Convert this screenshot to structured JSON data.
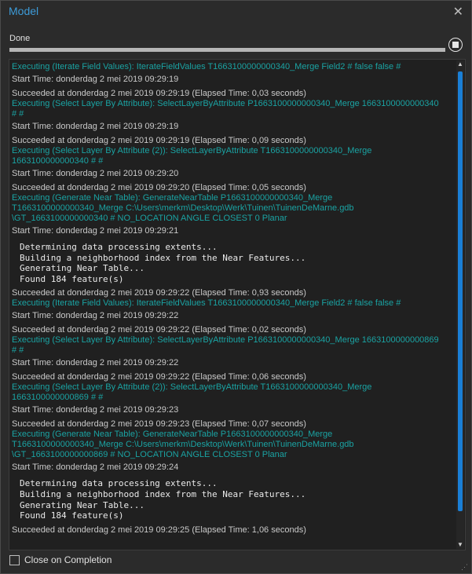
{
  "window": {
    "title": "Model"
  },
  "status": {
    "text": "Done",
    "progress": 1.0
  },
  "log": [
    {
      "kind": "exec",
      "text": "Executing (Iterate Field Values): IterateFieldValues T1663100000000340_Merge Field2 # false false #"
    },
    {
      "kind": "plain",
      "text": "Start Time: donderdag 2 mei 2019 09:29:19"
    },
    {
      "kind": "plain",
      "text": "Succeeded at donderdag 2 mei 2019 09:29:19 (Elapsed Time: 0,03 seconds)"
    },
    {
      "kind": "exec",
      "text": "Executing (Select Layer By Attribute): SelectLayerByAttribute P1663100000000340_Merge 1663100000000340"
    },
    {
      "kind": "exec",
      "text": "# #"
    },
    {
      "kind": "plain",
      "text": "Start Time: donderdag 2 mei 2019 09:29:19"
    },
    {
      "kind": "plain",
      "text": "Succeeded at donderdag 2 mei 2019 09:29:19 (Elapsed Time: 0,09 seconds)"
    },
    {
      "kind": "exec",
      "text": "Executing (Select Layer By Attribute (2)): SelectLayerByAttribute T1663100000000340_Merge"
    },
    {
      "kind": "exec",
      "text": "1663100000000340 # #"
    },
    {
      "kind": "plain",
      "text": "Start Time: donderdag 2 mei 2019 09:29:20"
    },
    {
      "kind": "plain",
      "text": "Succeeded at donderdag 2 mei 2019 09:29:20 (Elapsed Time: 0,05 seconds)"
    },
    {
      "kind": "exec",
      "text": "Executing (Generate Near Table): GenerateNearTable P1663100000000340_Merge"
    },
    {
      "kind": "exec",
      "text": "T1663100000000340_Merge C:\\Users\\merkm\\Desktop\\Werk\\Tuinen\\TuinenDeMarne.gdb"
    },
    {
      "kind": "exec",
      "text": "\\GT_1663100000000340 # NO_LOCATION ANGLE CLOSEST 0 Planar"
    },
    {
      "kind": "plain",
      "text": "Start Time: donderdag 2 mei 2019 09:29:21"
    },
    {
      "kind": "mono",
      "lines": [
        "Determining data processing extents...",
        "Building a neighborhood index from the Near Features...",
        "Generating Near Table...",
        "Found 184 feature(s)"
      ]
    },
    {
      "kind": "plain",
      "text": "Succeeded at donderdag 2 mei 2019 09:29:22 (Elapsed Time: 0,93 seconds)"
    },
    {
      "kind": "exec",
      "text": "Executing (Iterate Field Values): IterateFieldValues T1663100000000340_Merge Field2 # false false #"
    },
    {
      "kind": "plain",
      "text": "Start Time: donderdag 2 mei 2019 09:29:22"
    },
    {
      "kind": "plain",
      "text": "Succeeded at donderdag 2 mei 2019 09:29:22 (Elapsed Time: 0,02 seconds)"
    },
    {
      "kind": "exec",
      "text": "Executing (Select Layer By Attribute): SelectLayerByAttribute P1663100000000340_Merge 1663100000000869"
    },
    {
      "kind": "exec",
      "text": "# #"
    },
    {
      "kind": "plain",
      "text": "Start Time: donderdag 2 mei 2019 09:29:22"
    },
    {
      "kind": "plain",
      "text": "Succeeded at donderdag 2 mei 2019 09:29:22 (Elapsed Time: 0,06 seconds)"
    },
    {
      "kind": "exec",
      "text": "Executing (Select Layer By Attribute (2)): SelectLayerByAttribute T1663100000000340_Merge"
    },
    {
      "kind": "exec",
      "text": "1663100000000869 # #"
    },
    {
      "kind": "plain",
      "text": "Start Time: donderdag 2 mei 2019 09:29:23"
    },
    {
      "kind": "plain",
      "text": "Succeeded at donderdag 2 mei 2019 09:29:23 (Elapsed Time: 0,07 seconds)"
    },
    {
      "kind": "exec",
      "text": "Executing (Generate Near Table): GenerateNearTable P1663100000000340_Merge"
    },
    {
      "kind": "exec",
      "text": "T1663100000000340_Merge C:\\Users\\merkm\\Desktop\\Werk\\Tuinen\\TuinenDeMarne.gdb"
    },
    {
      "kind": "exec",
      "text": "\\GT_1663100000000869 # NO_LOCATION ANGLE CLOSEST 0 Planar"
    },
    {
      "kind": "plain",
      "text": "Start Time: donderdag 2 mei 2019 09:29:24"
    },
    {
      "kind": "mono",
      "lines": [
        "Determining data processing extents...",
        "Building a neighborhood index from the Near Features...",
        "Generating Near Table...",
        "Found 184 feature(s)"
      ]
    },
    {
      "kind": "plain",
      "text": "Succeeded at donderdag 2 mei 2019 09:29:25 (Elapsed Time: 1,06 seconds)"
    }
  ],
  "footer": {
    "close_on_completion_label": "Close on Completion",
    "close_on_completion_checked": false
  },
  "icons": {
    "close": "close-icon",
    "stop": "stop-icon",
    "scroll_up": "scroll-up-icon",
    "scroll_down": "scroll-down-icon",
    "resize": "resize-grip-icon"
  },
  "colors": {
    "title": "#3d9bd8",
    "exec_text": "#1aa3a3",
    "scroll_thumb": "#1a7fd6",
    "background": "#2b2b2b"
  }
}
